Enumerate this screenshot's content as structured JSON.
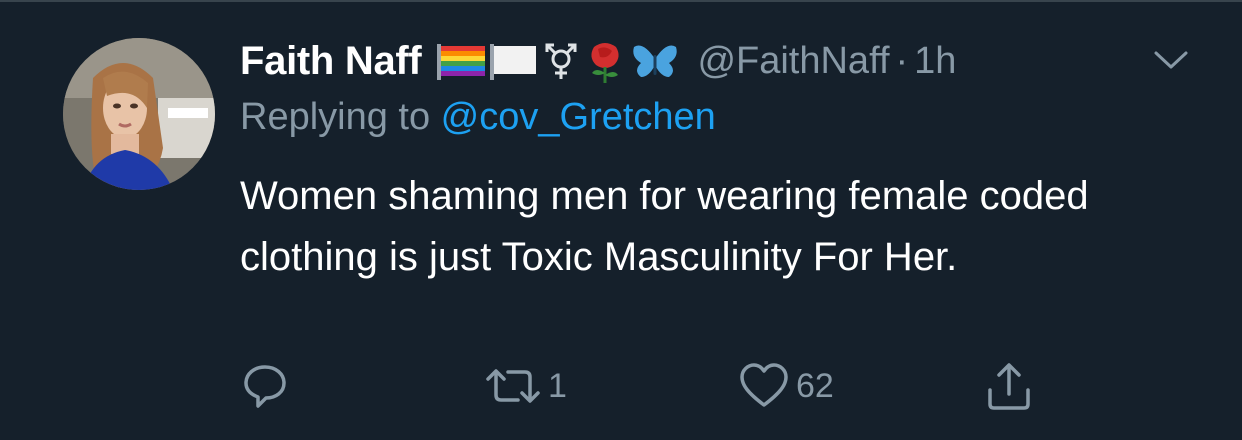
{
  "tweet": {
    "display_name": "Faith Naff",
    "badges": [
      "rainbow-flag-icon",
      "white-flag-icon",
      "transgender-symbol-icon",
      "rose-icon",
      "butterfly-icon"
    ],
    "handle": "@FaithNaff",
    "separator": "·",
    "time": "1h",
    "reply_prefix": "Replying to ",
    "reply_to": "@cov_Gretchen",
    "text": "Women shaming men for wearing female coded clothing is just Toxic Masculinity For Her."
  },
  "actions": {
    "reply_icon": "reply-bubble-icon",
    "retweet_icon": "retweet-icon",
    "retweet_count": "1",
    "like_icon": "heart-icon",
    "like_count": "62",
    "share_icon": "share-icon"
  },
  "colors": {
    "background": "#15202b",
    "text": "#ffffff",
    "secondary": "#8899a6",
    "link": "#1da1f2",
    "divider": "#38444d"
  }
}
